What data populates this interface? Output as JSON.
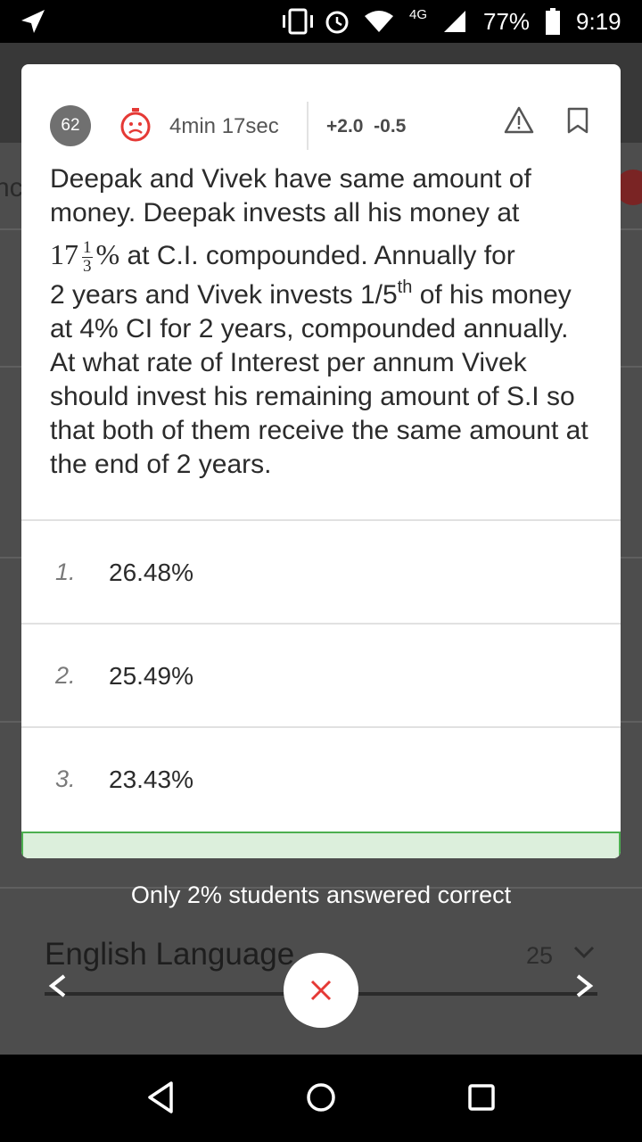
{
  "status_bar": {
    "network": "4G",
    "battery": "77%",
    "time": "9:19"
  },
  "background": {
    "left_tab_fragment": "nc",
    "correct_note": "Only 2% students answered correct",
    "section_name": "English Language",
    "section_count": "25"
  },
  "question_card": {
    "number": "62",
    "timer": "4min 17sec",
    "marks_positive": "+2.0",
    "marks_negative": "-0.5",
    "text_part1": "Deepak and Vivek have same amount of money. Deepak invests all his money at",
    "rate_whole": "17",
    "rate_frac_num": "1",
    "rate_frac_den": "3",
    "rate_pct": "%",
    "text_part2": "at C.I. compounded. Annually for",
    "text_part3_pre": "2 years and Vivek invests 1/5",
    "text_part3_sup": "th",
    "text_part3_post": "of his money at 4% CI for 2 years, compounded annually. At what rate of Interest per annum Vivek should invest his remaining amount of S.I so that both of them receive the same amount at the end of 2 years.",
    "options": [
      {
        "num": "1.",
        "text": "26.48%"
      },
      {
        "num": "2.",
        "text": "25.49%"
      },
      {
        "num": "3.",
        "text": "23.43%"
      }
    ]
  },
  "colors": {
    "timer_red": "#e53935",
    "correct_green": "#4caf50"
  },
  "icons": [
    "vibrate-icon",
    "alarm-icon",
    "wifi-icon",
    "signal-icon",
    "battery-icon",
    "timer-sad-icon",
    "report-icon",
    "bookmark-icon",
    "close-icon",
    "back-icon",
    "home-icon",
    "recents-icon"
  ]
}
